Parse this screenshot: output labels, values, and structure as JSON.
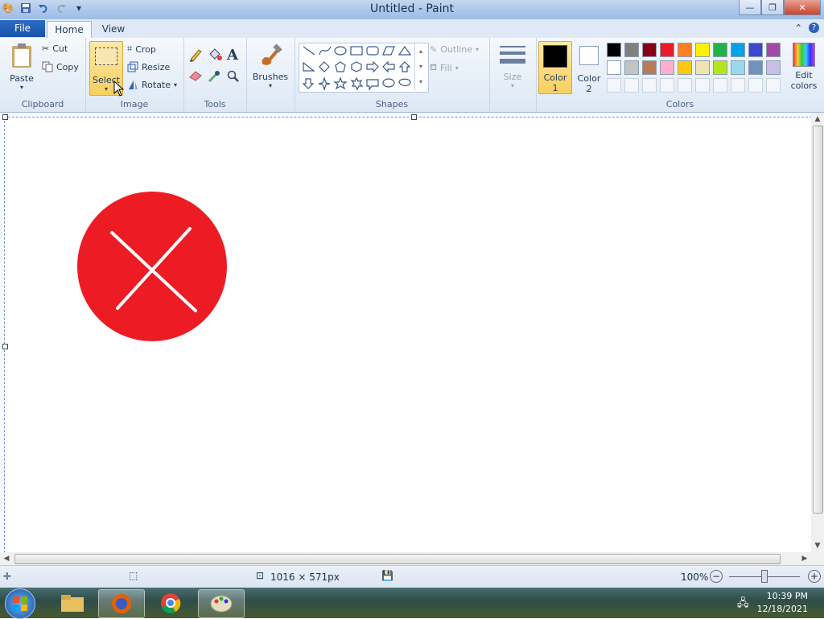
{
  "window": {
    "title": "Untitled - Paint"
  },
  "tabs": {
    "file": "File",
    "home": "Home",
    "view": "View"
  },
  "clipboard": {
    "paste": "Paste",
    "cut": "Cut",
    "copy": "Copy",
    "label": "Clipboard"
  },
  "image": {
    "select": "Select",
    "crop": "Crop",
    "resize": "Resize",
    "rotate": "Rotate",
    "label": "Image"
  },
  "tools": {
    "label": "Tools"
  },
  "brushes": {
    "label": "Brushes"
  },
  "shapes": {
    "outline": "Outline",
    "fill": "Fill",
    "label": "Shapes"
  },
  "size": {
    "label": "Size"
  },
  "colors": {
    "color1_line1": "Color",
    "color1_line2": "1",
    "color2_line1": "Color",
    "color2_line2": "2",
    "edit_line1": "Edit",
    "edit_line2": "colors",
    "label": "Colors",
    "color1": "#000000",
    "color2": "#ffffff",
    "palette_row1": [
      "#000000",
      "#7f7f7f",
      "#880015",
      "#ed1c24",
      "#ff7f27",
      "#fff200",
      "#22b14c",
      "#00a2e8",
      "#3f48cc",
      "#a349a4"
    ],
    "palette_row2": [
      "#ffffff",
      "#c3c3c3",
      "#b97a57",
      "#ffaec9",
      "#ffc90e",
      "#efe4b0",
      "#b5e61d",
      "#99d9ea",
      "#7092be",
      "#c8bfe7"
    ]
  },
  "canvas": {
    "shape_color": "#ed1c24",
    "cross_color": "#ffffff"
  },
  "status": {
    "dimensions": "1016 × 571px",
    "zoom": "100%"
  },
  "taskbar": {
    "time": "10:39 PM",
    "date": "12/18/2021"
  }
}
